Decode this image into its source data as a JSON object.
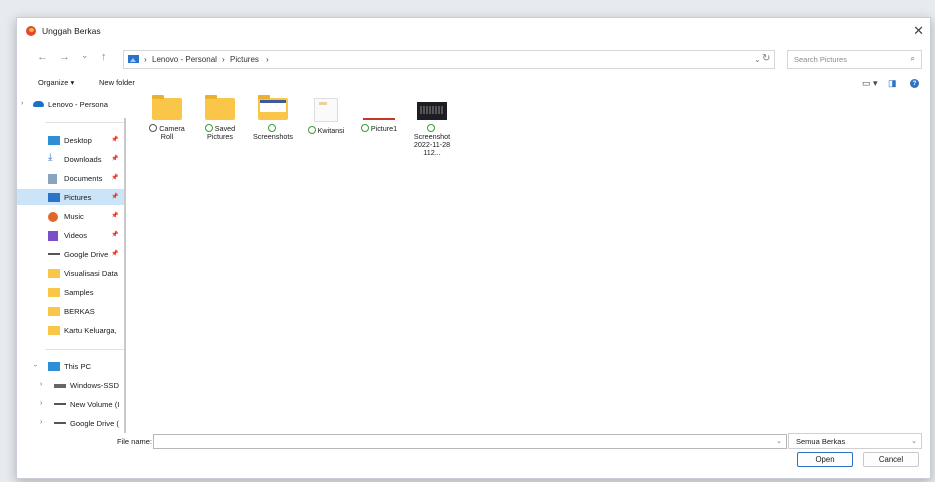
{
  "window": {
    "title": "Unggah Berkas",
    "close_glyph": "✕"
  },
  "nav": {
    "back": "←",
    "forward": "→",
    "recent": "⌄",
    "up": "↑",
    "breadcrumb": [
      "Lenovo - Personal",
      "Pictures"
    ],
    "separator": "›",
    "refresh": "↻",
    "addr_dropdown": "⌄",
    "search_placeholder": "Search Pictures",
    "search_icon": "⌕"
  },
  "toolbar": {
    "organize": "Organize ▾",
    "new_folder": "New folder",
    "view_glyph": "▭ ▾",
    "pane_glyph": "◨",
    "help_glyph": "?"
  },
  "sidebar": {
    "cloud_root": "Lenovo - Personal",
    "pinned": [
      {
        "label": "Desktop",
        "icon": "desktop-icon"
      },
      {
        "label": "Downloads",
        "icon": "download-icon"
      },
      {
        "label": "Documents",
        "icon": "documents-icon"
      },
      {
        "label": "Pictures",
        "icon": "pictures-icon"
      },
      {
        "label": "Music",
        "icon": "music-icon"
      },
      {
        "label": "Videos",
        "icon": "videos-icon"
      },
      {
        "label": "Google Drive",
        "icon": "drive-icon"
      }
    ],
    "folders": [
      "Visualisasi Data",
      "Samples",
      "BERKAS",
      "Kartu Keluarga,"
    ],
    "this_pc": "This PC",
    "drives": [
      "Windows-SSD",
      "New Volume (I",
      "Google Drive ("
    ]
  },
  "files": [
    {
      "name": "Camera Roll",
      "type": "folder",
      "status": "cloud"
    },
    {
      "name": "Saved Pictures",
      "type": "folder",
      "status": "synced"
    },
    {
      "name": "Screenshots",
      "type": "shot-folder",
      "status": "synced"
    },
    {
      "name": "Kwitansi",
      "type": "doc",
      "status": "synced"
    },
    {
      "name": "Picture1",
      "type": "pic",
      "status": "synced"
    },
    {
      "name": "Screenshot 2022-11-28 112...",
      "type": "kbd",
      "status": "synced"
    }
  ],
  "footer": {
    "file_name_label": "File name:",
    "file_name_value": "",
    "filter": "Semua Berkas",
    "open": "Open",
    "cancel": "Cancel"
  },
  "colors": {
    "accent": "#2b72c9",
    "selected": "#cce4f7",
    "folder": "#f9c64a"
  }
}
